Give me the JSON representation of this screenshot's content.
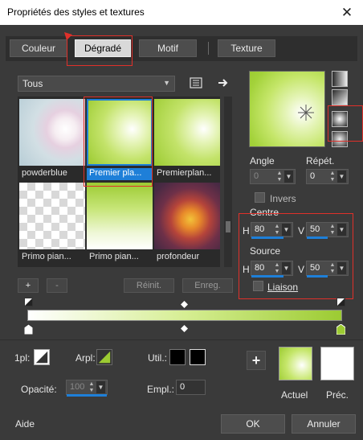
{
  "window": {
    "title": "Propriétés des styles et textures",
    "close_glyph": "✕"
  },
  "tabs": [
    "Couleur",
    "Dégradé",
    "Motif",
    "Texture"
  ],
  "category": {
    "selected": "Tous"
  },
  "gradients": [
    {
      "name": "powderblue",
      "selected": false
    },
    {
      "name": "Premier pla...",
      "selected": true
    },
    {
      "name": "Premierplan...",
      "selected": false
    },
    {
      "name": "Primo pian...",
      "selected": false
    },
    {
      "name": "Primo pian...",
      "selected": false
    },
    {
      "name": "profondeur",
      "selected": false
    }
  ],
  "buttons": {
    "add": "+",
    "remove": "-",
    "reset": "Réinit.",
    "save": "Enreg."
  },
  "angle": {
    "label": "Angle",
    "value": "0"
  },
  "repeat": {
    "label": "Répét.",
    "value": "0"
  },
  "invert": {
    "label": "Invers"
  },
  "centre": {
    "label": "Centre",
    "h_label": "H",
    "h": "80",
    "v_label": "V",
    "v": "50"
  },
  "source": {
    "label": "Source",
    "h_label": "H",
    "h": "80",
    "v_label": "V",
    "v": "50"
  },
  "link": {
    "label": "Liaison"
  },
  "bottom": {
    "first_plan_label": "1pl:",
    "arpl_label": "Arpl:",
    "util_label": "Util.:",
    "opacity_label": "Opacité:",
    "opacity_value": "100",
    "empl_label": "Empl.:",
    "empl_value": "0",
    "plus": "+",
    "current_label": "Actuel",
    "previous_label": "Préc."
  },
  "footer": {
    "help": "Aide",
    "ok": "OK",
    "cancel": "Annuler"
  },
  "colors": {
    "gradient_start": "#ffffff",
    "gradient_end": "#9ccb32",
    "accent": "#1e7fd8",
    "highlight": "#e0302a"
  }
}
